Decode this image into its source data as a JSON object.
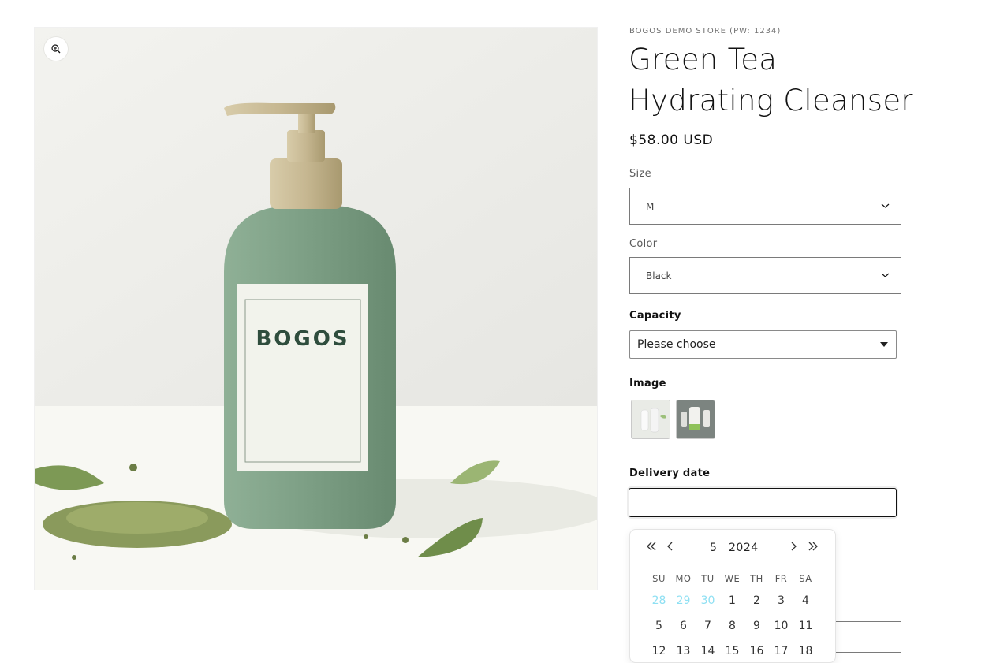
{
  "product": {
    "vendor": "BOGOS DEMO STORE (PW: 1234)",
    "title": "Green Tea Hydrating Cleanser",
    "price": "$58.00 USD",
    "image_brand": "BOGOS"
  },
  "options": {
    "size": {
      "label": "Size",
      "value": "M"
    },
    "color": {
      "label": "Color",
      "value": "Black"
    }
  },
  "capacity": {
    "label": "Capacity",
    "value": "Please choose"
  },
  "image_option": {
    "label": "Image",
    "thumbs": [
      "thumb-1",
      "thumb-2"
    ]
  },
  "delivery": {
    "label": "Delivery date",
    "value": "",
    "calendar": {
      "month": "5",
      "year": "2024",
      "weekdays": [
        "SU",
        "MO",
        "TU",
        "WE",
        "TH",
        "FR",
        "SA"
      ],
      "weeks": [
        [
          "28",
          "29",
          "30",
          "1",
          "2",
          "3",
          "4"
        ],
        [
          "5",
          "6",
          "7",
          "8",
          "9",
          "10",
          "11"
        ],
        [
          "12",
          "13",
          "14",
          "15",
          "16",
          "17",
          "18"
        ]
      ]
    }
  },
  "colors": {
    "bottle": "#7ea086",
    "outside_day": "#8fe0f3",
    "text": "#121212"
  },
  "icons": [
    "zoom-in-icon",
    "chevron-down-icon",
    "double-chevron-left-icon",
    "chevron-left-icon",
    "chevron-right-icon",
    "double-chevron-right-icon"
  ]
}
